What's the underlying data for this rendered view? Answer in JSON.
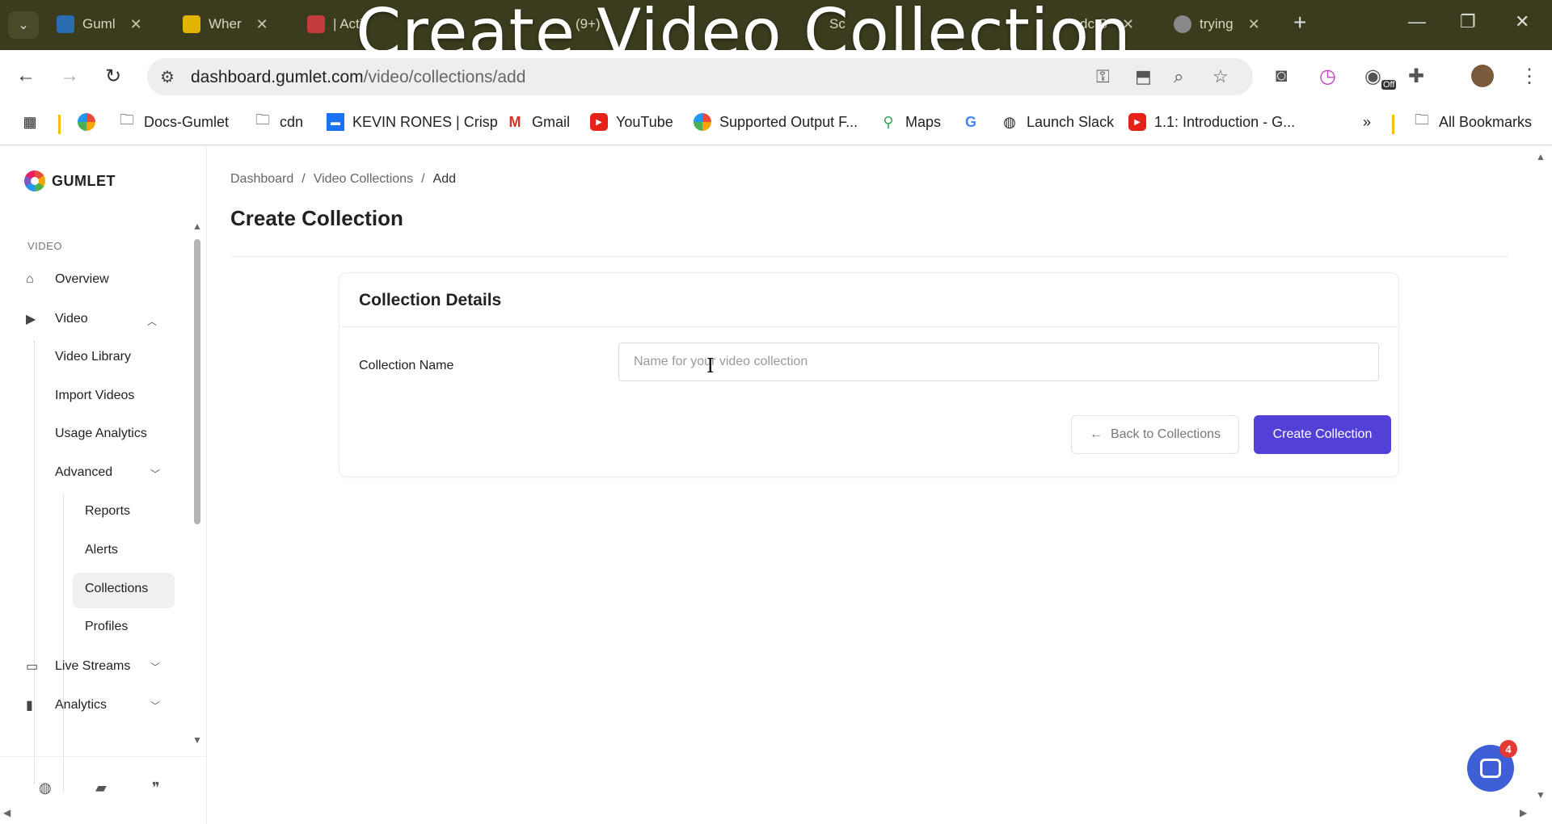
{
  "overlay_title": "Create Video Collection",
  "browser": {
    "tabs": [
      {
        "label": "Guml",
        "color": "#2a6cb0"
      },
      {
        "label": "Wher",
        "color": "#e0b400"
      },
      {
        "label": "| Acti",
        "color": "#c43b3b"
      },
      {
        "label": "(9+)",
        "color": ""
      },
      {
        "label": "Sc",
        "color": ""
      },
      {
        "label": "dc S",
        "color": ""
      },
      {
        "label": "trying",
        "color": "#888888"
      }
    ],
    "url_host": "dashboard.gumlet.com",
    "url_path": "/video/collections/add",
    "ext_off_label": "Off",
    "bookmarks": [
      {
        "label": "Docs-Gumlet",
        "icon": "folder-icon"
      },
      {
        "label": "cdn",
        "icon": "folder-icon"
      },
      {
        "label": "KEVIN RONES | Crisp",
        "icon": "crisp-icon"
      },
      {
        "label": "Gmail",
        "icon": "gmail-icon"
      },
      {
        "label": "YouTube",
        "icon": "youtube-icon"
      },
      {
        "label": "Supported Output F...",
        "icon": "gumlet-icon"
      },
      {
        "label": "Maps",
        "icon": "maps-icon"
      },
      {
        "label": "Launch Slack",
        "icon": "globe-icon"
      },
      {
        "label": "1.1: Introduction - G...",
        "icon": "youtube-icon"
      }
    ],
    "all_bookmarks": "All Bookmarks"
  },
  "sidebar": {
    "logo": "GUMLET",
    "section": "VIDEO",
    "items": {
      "overview": "Overview",
      "video": "Video",
      "video_library": "Video Library",
      "import_videos": "Import Videos",
      "usage_analytics": "Usage Analytics",
      "advanced": "Advanced",
      "reports": "Reports",
      "alerts": "Alerts",
      "collections": "Collections",
      "profiles": "Profiles",
      "live_streams": "Live Streams",
      "analytics": "Analytics"
    }
  },
  "main": {
    "breadcrumb": [
      "Dashboard",
      "Video Collections",
      "Add"
    ],
    "title": "Create Collection",
    "card": {
      "title": "Collection Details",
      "field_label": "Collection Name",
      "field_value": "",
      "field_placeholder": "Name for your video collection",
      "back_button": "Back to Collections",
      "create_button": "Create Collection"
    }
  },
  "chat": {
    "badge": "4"
  },
  "colors": {
    "primary": "#5340d7",
    "chat": "#3f5fd6",
    "badge": "#e53935"
  }
}
